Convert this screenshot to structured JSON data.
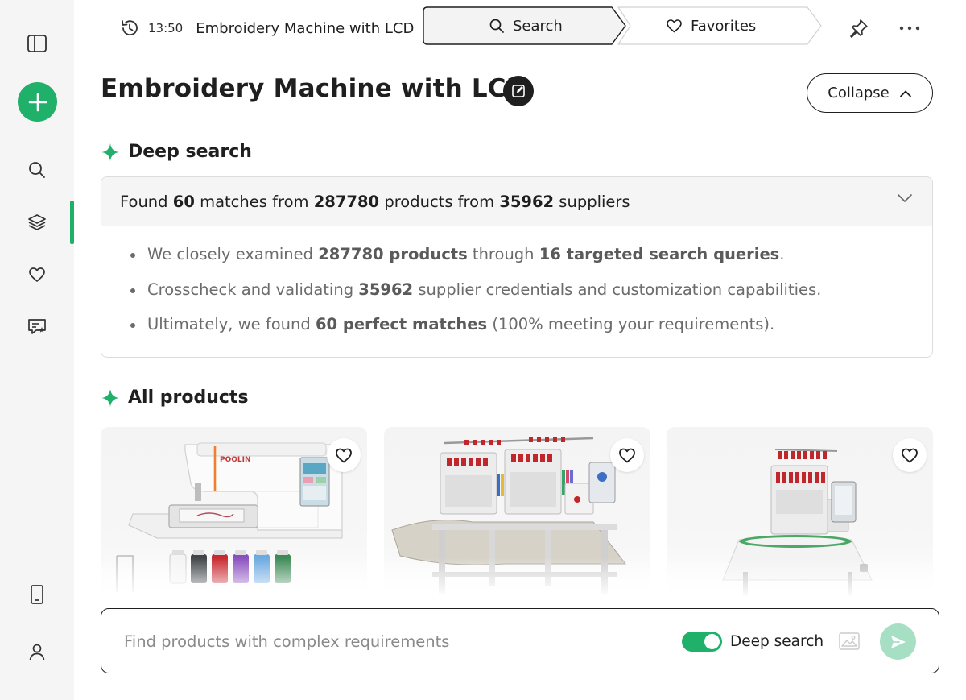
{
  "sidebar": {
    "items": [
      {
        "name": "toggle-sidebar",
        "icon": "panel-icon"
      },
      {
        "name": "new-chat",
        "icon": "plus-icon"
      },
      {
        "name": "search",
        "icon": "search-icon"
      },
      {
        "name": "layers",
        "icon": "layers-icon",
        "active": true
      },
      {
        "name": "favorites",
        "icon": "heart-icon"
      },
      {
        "name": "messages",
        "icon": "message-star-icon"
      },
      {
        "name": "mobile",
        "icon": "phone-icon"
      },
      {
        "name": "account",
        "icon": "user-icon"
      }
    ],
    "accent_color": "#1fb06a"
  },
  "topbar": {
    "history_time": "13:50",
    "history_title": "Embroidery Machine with LCD",
    "tabs": [
      {
        "label": "Search",
        "icon": "search-icon",
        "active": true
      },
      {
        "label": "Favorites",
        "icon": "heart-icon",
        "active": false
      }
    ]
  },
  "main": {
    "title": "Embroidery Machine with LCD",
    "collapse_label": "Collapse",
    "deep_search": {
      "heading": "Deep search",
      "summary": {
        "p1": "Found ",
        "matches": "60",
        "p2": " matches from ",
        "products": "287780",
        "p3": " products from ",
        "suppliers": "35962",
        "p4": " suppliers"
      },
      "bullets": [
        {
          "a": "We closely examined ",
          "b": "287780 products",
          "c": " through ",
          "d": "16 targeted search queries",
          "e": "."
        },
        {
          "a": "Crosscheck and validating ",
          "b": "35962",
          "c": " supplier credentials and customization capabilities.",
          "d": "",
          "e": ""
        },
        {
          "a": "Ultimately, we found ",
          "b": "60 perfect matches",
          "c": " (100% meeting your requirements).",
          "d": "",
          "e": ""
        }
      ]
    },
    "all_products": {
      "heading": "All products",
      "cards": [
        {
          "brand_text": "POOLIN"
        },
        {},
        {}
      ]
    }
  },
  "composer": {
    "placeholder": "Find products with complex requirements",
    "deep_search_label": "Deep search",
    "deep_search_enabled": true
  }
}
